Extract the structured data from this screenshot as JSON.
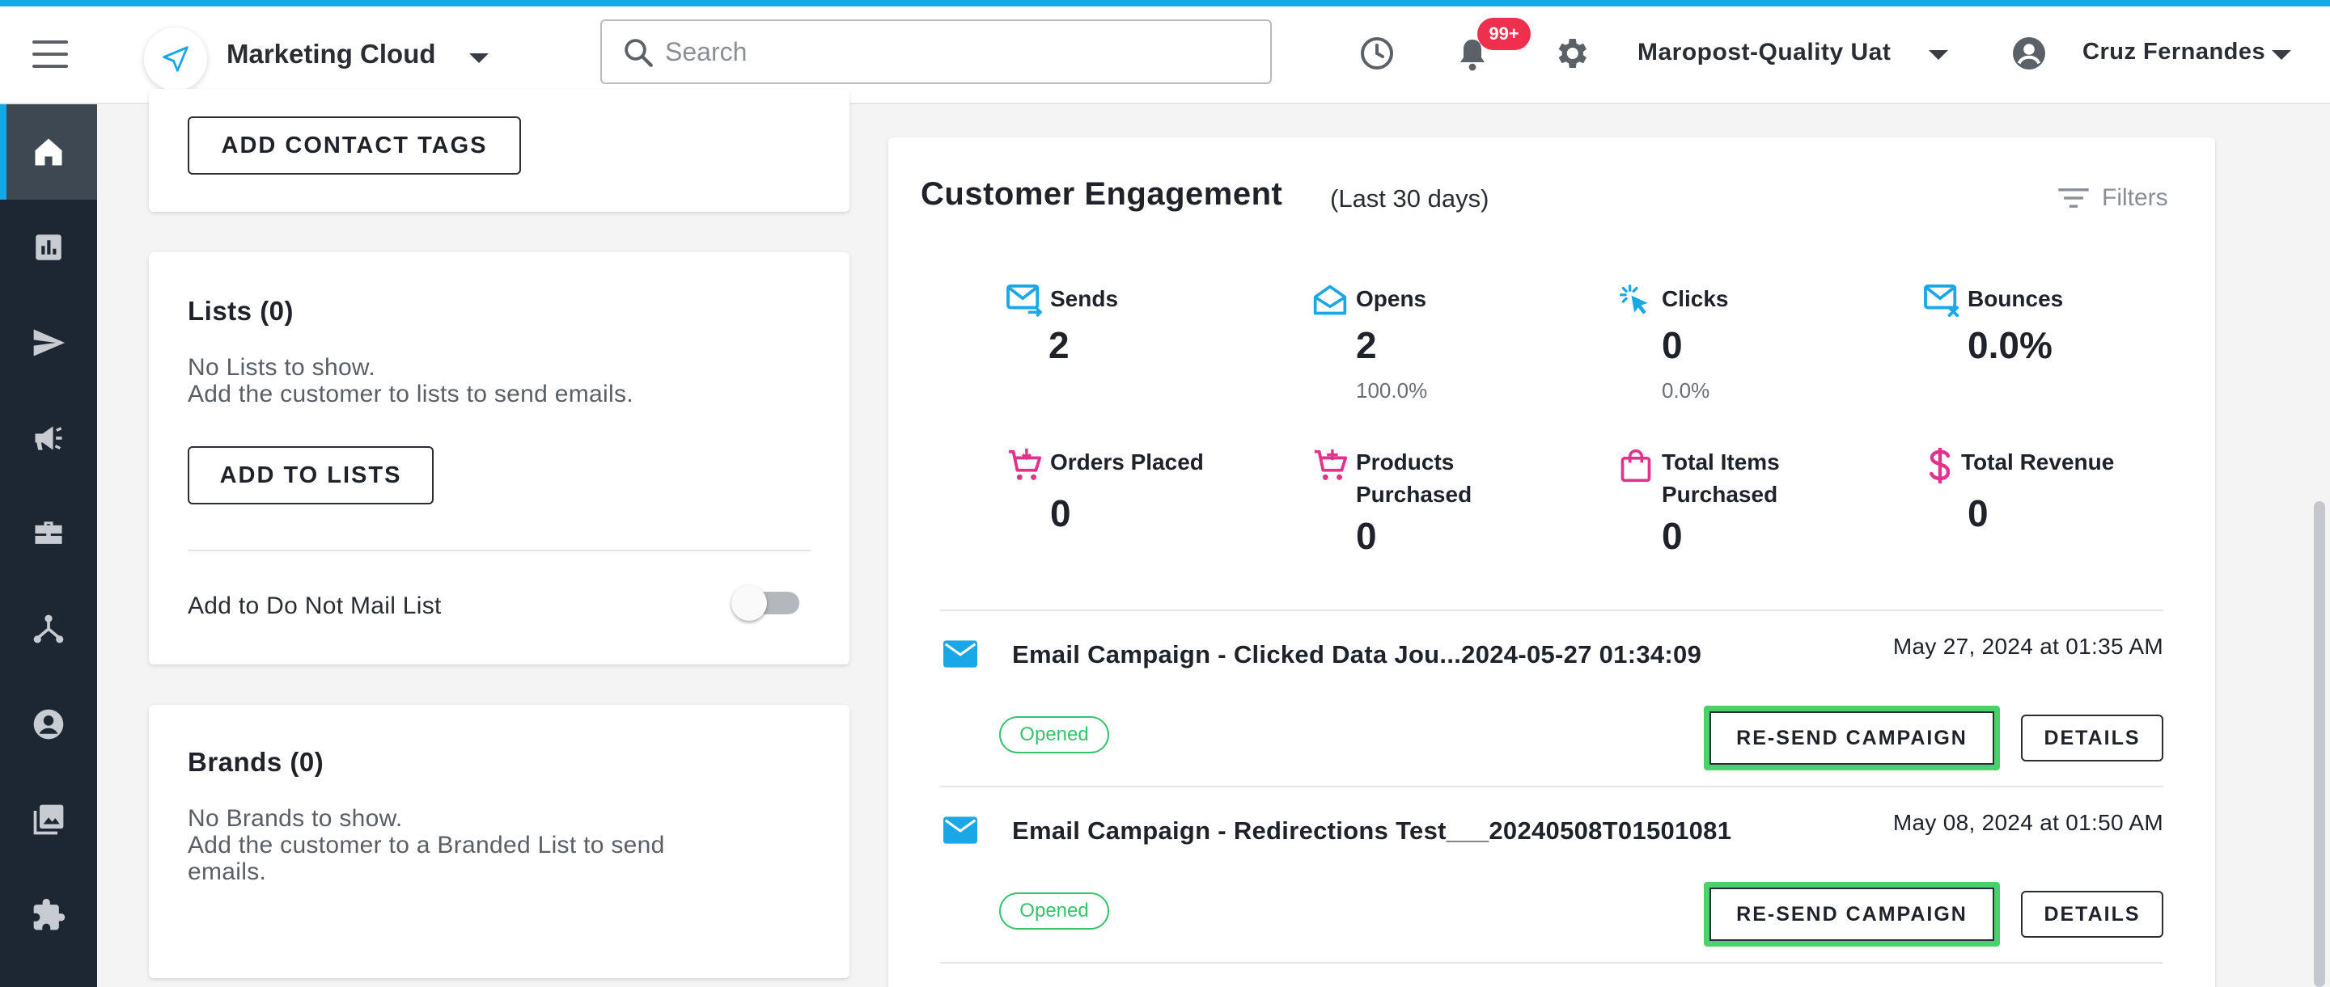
{
  "header": {
    "product_name": "Marketing Cloud",
    "search_placeholder": "Search",
    "notification_count": "99+",
    "account_name": "Maropost-Quality Uat",
    "user_name": "Cruz Fernandes"
  },
  "sidebar": {
    "items": [
      {
        "icon": "home-icon",
        "active": true
      },
      {
        "icon": "reports-icon"
      },
      {
        "icon": "send-icon"
      },
      {
        "icon": "megaphone-icon"
      },
      {
        "icon": "briefcase-icon"
      },
      {
        "icon": "journey-icon"
      },
      {
        "icon": "contact-icon"
      },
      {
        "icon": "media-icon"
      },
      {
        "icon": "extension-icon"
      }
    ]
  },
  "left_panel": {
    "add_contact_tags_label": "ADD CONTACT TAGS",
    "lists": {
      "title": "Lists (0)",
      "empty_line1": "No Lists to show.",
      "empty_line2": "Add the customer to lists to send emails.",
      "add_button_label": "ADD TO LISTS",
      "do_not_mail_label": "Add to Do Not Mail List",
      "do_not_mail_enabled": false
    },
    "brands": {
      "title": "Brands (0)",
      "empty_line1": "No Brands to show.",
      "empty_line2": "Add the customer to a Branded List to send",
      "empty_line3": "emails."
    }
  },
  "engagement": {
    "title": "Customer Engagement",
    "subtitle": "(Last 30 days)",
    "filters_label": "Filters",
    "metrics": [
      {
        "label": "Sends",
        "value": "2",
        "pct": ""
      },
      {
        "label": "Opens",
        "value": "2",
        "pct": "100.0%"
      },
      {
        "label": "Clicks",
        "value": "0",
        "pct": "0.0%"
      },
      {
        "label": "Bounces",
        "value": "0.0%",
        "pct": ""
      },
      {
        "label_line1": "Orders Placed",
        "label_line2": "",
        "value": "0"
      },
      {
        "label_line1": "Products",
        "label_line2": "Purchased",
        "value": "0"
      },
      {
        "label_line1": "Total Items",
        "label_line2": "Purchased",
        "value": "0"
      },
      {
        "label_line1": "Total Revenue",
        "label_line2": "",
        "value": "0"
      }
    ],
    "campaigns": [
      {
        "title": "Email Campaign - Clicked Data Jou...2024-05-27 01:34:09",
        "date": "May 27, 2024 at 01:35 AM",
        "status": "Opened",
        "resend_label": "RE-SEND CAMPAIGN",
        "details_label": "DETAILS"
      },
      {
        "title": "Email Campaign - Redirections Test___20240508T01501081",
        "date": "May 08, 2024 at 01:50 AM",
        "status": "Opened",
        "resend_label": "RE-SEND CAMPAIGN",
        "details_label": "DETAILS"
      }
    ]
  },
  "colors": {
    "accent": "#13a9e8",
    "sidebar_bg": "#1d2733",
    "engagement_blue": "#1aa7e5",
    "conversion_pink": "#e2338c",
    "status_green": "#35c46b",
    "highlight_green": "#4bd16b",
    "badge_red": "#ee2f4e"
  }
}
